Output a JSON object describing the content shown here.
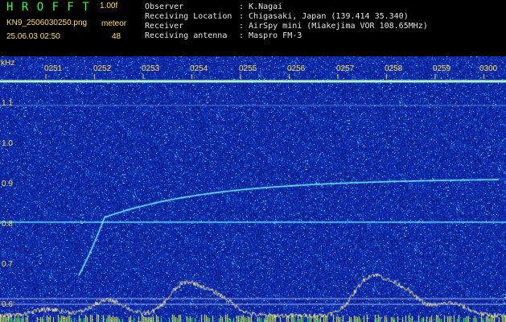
{
  "header": {
    "logo": "H R O F F T",
    "version": "1.00f",
    "filename": "KN9_2506030250.png",
    "timestamp": "25.06.03 02:50",
    "meteor_label": "meteor",
    "meteor_count": "48"
  },
  "metadata": [
    {
      "label": "Observer",
      "value": ": K.Nagai"
    },
    {
      "label": "Receiving Location",
      "value": ": Chigasaki, Japan (139.414 35.340)"
    },
    {
      "label": "Receiver",
      "value": ": AirSpy mini (Miakejima VOR 108.65MHz)"
    },
    {
      "label": "Receiving antenna",
      "value": ": Maspro FM-3"
    }
  ],
  "axis": {
    "y_unit": "kHz",
    "y_ticks": [
      "1.1",
      "1.0",
      "0.9",
      "0.8",
      "0.7",
      "0.6"
    ],
    "x_ticks": [
      "0251",
      "0252",
      "0253",
      "0254",
      "0255",
      "0256",
      "0257",
      "0258",
      "0259",
      "0300"
    ]
  },
  "colors": {
    "background": "#0f2bb0",
    "header_text": "#e6e6e6",
    "logo": "#39ff3a",
    "axis_text": "#ffe04a"
  }
}
